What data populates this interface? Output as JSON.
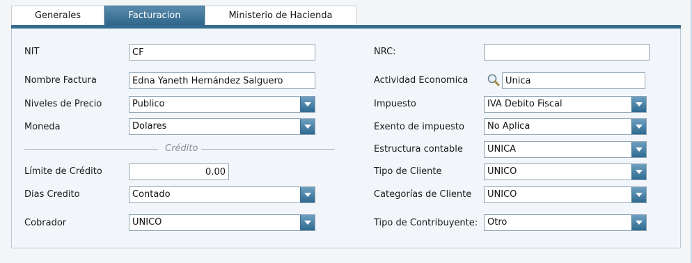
{
  "tabs": [
    {
      "label": "Generales",
      "active": false
    },
    {
      "label": "Facturacion",
      "active": true
    },
    {
      "label": "Ministerio de Hacienda",
      "active": false
    }
  ],
  "left": {
    "nit_label": "NIT",
    "nit_value": "CF",
    "nombre_label": "Nombre Factura",
    "nombre_value": "Edna Yaneth Hernández Salguero",
    "niveles_label": "Niveles de Precio",
    "niveles_value": "Publico",
    "moneda_label": "Moneda",
    "moneda_value": "Dolares",
    "credito_section": "Crédito",
    "limite_label": "Límite de Crédito",
    "limite_value": "0.00",
    "dias_label": "Dias Credito",
    "dias_value": "Contado",
    "cobrador_label": "Cobrador",
    "cobrador_value": "UNICO"
  },
  "right": {
    "nrc_label": "NRC:",
    "nrc_value": "",
    "actividad_label": "Actividad Economica",
    "actividad_value": "Unica",
    "impuesto_label": "Impuesto",
    "impuesto_value": "IVA Debito Fiscal",
    "exento_label": "Exento de impuesto",
    "exento_value": "No Aplica",
    "estructura_label": "Estructura contable",
    "estructura_value": "UNICA",
    "tipo_cliente_label": "Tipo de Cliente",
    "tipo_cliente_value": "UNICO",
    "categorias_label": "Categorías de Cliente",
    "categorias_value": "UNICO",
    "contribuyente_label": "Tipo de Contribuyente:",
    "contribuyente_value": "Otro"
  },
  "icons": {
    "dropdown": "chevron-down-icon",
    "lookup": "magnifier-icon"
  },
  "colors": {
    "accent": "#2f6689",
    "panel_bg": "#f2f6fa"
  }
}
